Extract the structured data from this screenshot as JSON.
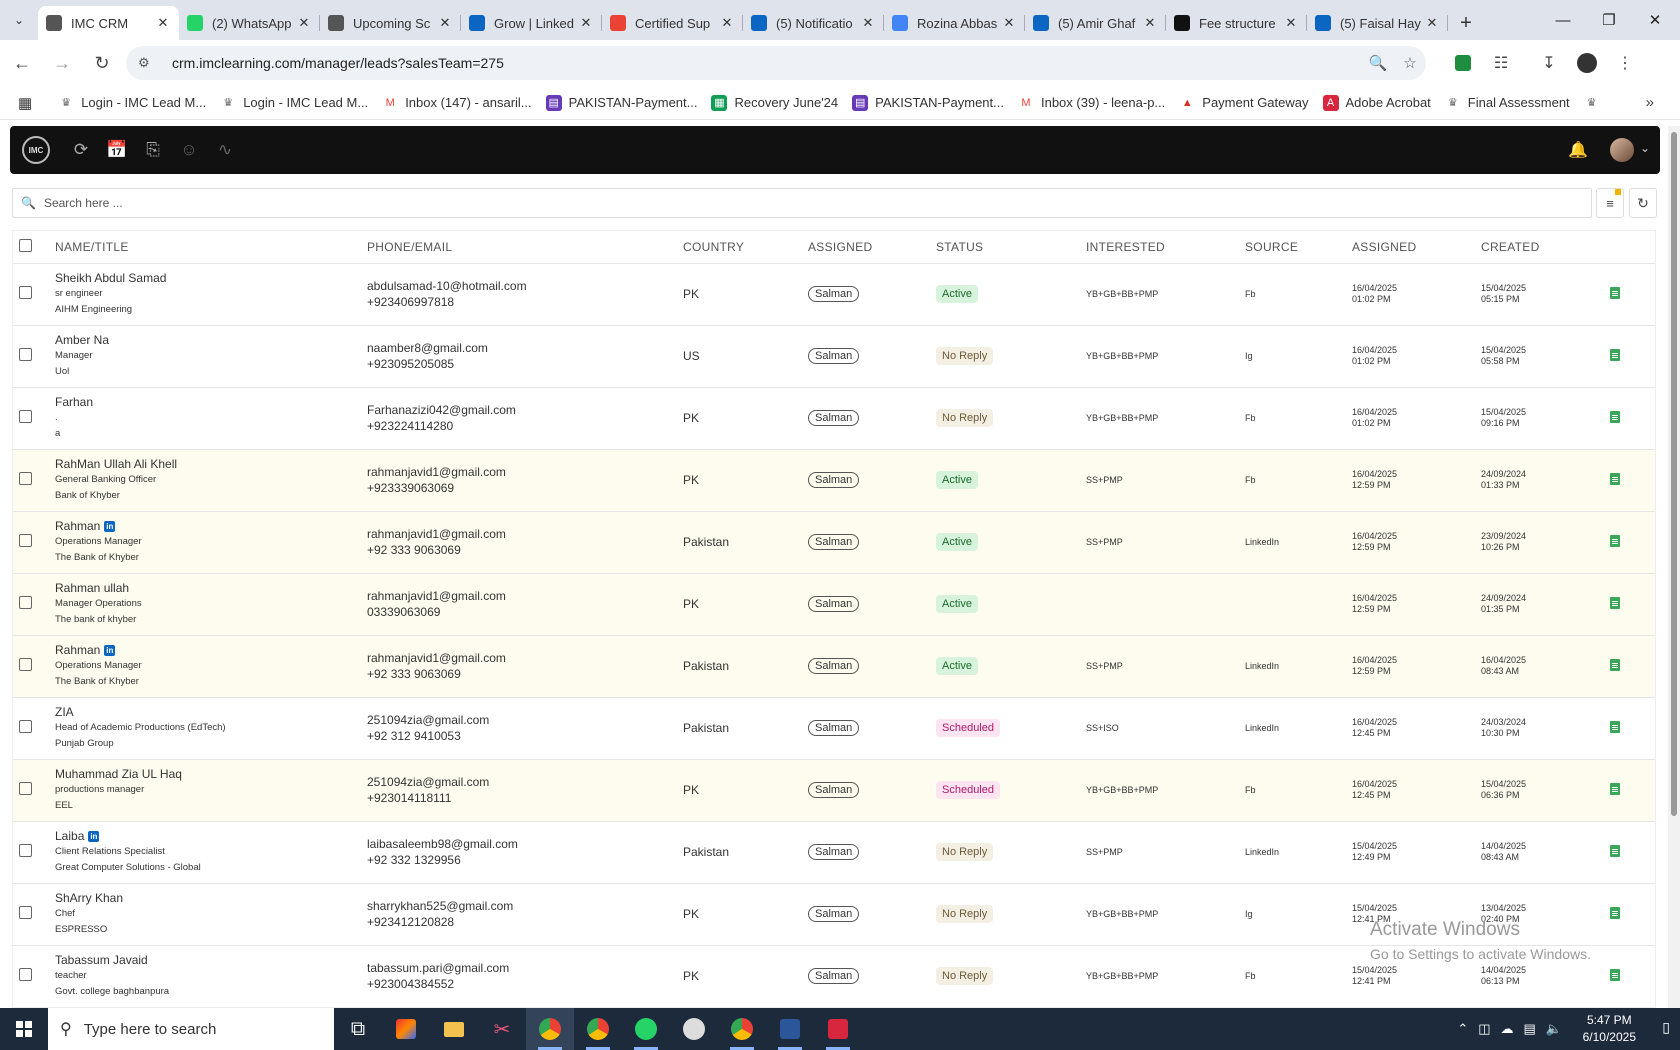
{
  "browser": {
    "tabs": [
      {
        "title": "IMC CRM",
        "active": true,
        "icon": "imc-icon",
        "color": "#555"
      },
      {
        "title": "(2) WhatsApp",
        "active": false,
        "icon": "whatsapp-icon",
        "color": "#25d366"
      },
      {
        "title": "Upcoming Sc",
        "active": false,
        "icon": "imc-icon",
        "color": "#555"
      },
      {
        "title": "Grow | Linked",
        "active": false,
        "icon": "linkedin-icon",
        "color": "#0a66c2"
      },
      {
        "title": "Certified Sup",
        "active": false,
        "icon": "gmail-icon",
        "color": "#ea4335"
      },
      {
        "title": "(5) Notificatio",
        "active": false,
        "icon": "linkedin-icon",
        "color": "#0a66c2"
      },
      {
        "title": "Rozina Abbas",
        "active": false,
        "icon": "google-icon",
        "color": "#4285f4"
      },
      {
        "title": "(5) Amir Ghaf",
        "active": false,
        "icon": "linkedin-icon",
        "color": "#0a66c2"
      },
      {
        "title": "Fee structure",
        "active": false,
        "icon": "openai-icon",
        "color": "#111"
      },
      {
        "title": "(5) Faisal Hay",
        "active": false,
        "icon": "linkedin-icon",
        "color": "#0a66c2"
      }
    ],
    "url": "crm.imclearning.com/manager/leads?salesTeam=275",
    "bookmarks": [
      {
        "label": "Login - IMC Lead M...",
        "icon": "imc-icon"
      },
      {
        "label": "Login - IMC Lead M...",
        "icon": "imc-icon"
      },
      {
        "label": "Inbox (147) - ansaril...",
        "icon": "gmail-icon"
      },
      {
        "label": "PAKISTAN-Payment...",
        "icon": "forms-icon"
      },
      {
        "label": "Recovery June'24",
        "icon": "sheets-icon"
      },
      {
        "label": "PAKISTAN-Payment...",
        "icon": "forms-icon"
      },
      {
        "label": "Inbox (39) - leena-p...",
        "icon": "gmail-icon"
      },
      {
        "label": "Payment Gateway",
        "icon": "arrow-icon"
      },
      {
        "label": "Adobe Acrobat",
        "icon": "acrobat-icon"
      },
      {
        "label": "Final Assessment",
        "icon": "imc-icon"
      }
    ]
  },
  "app": {
    "logo_text": "IMC",
    "search_placeholder": "Search here ..."
  },
  "table": {
    "headers": [
      "NAME/TITLE",
      "PHONE/EMAIL",
      "COUNTRY",
      "ASSIGNED",
      "STATUS",
      "INTERESTED",
      "SOURCE",
      "ASSIGNED",
      "CREATED"
    ],
    "rows": [
      {
        "name": "Sheikh Abdul Samad",
        "linkedin": false,
        "title": "sr engineer",
        "company": "AIHM Engineering",
        "email": "abdulsamad-10@hotmail.com",
        "phone": "+923406997818",
        "country": "PK",
        "assigned": "Salman",
        "status": "Active",
        "interested": "YB+GB+BB+PMP",
        "source": "Fb",
        "assigned_date": "16/04/2025",
        "assigned_time": "01:02 PM",
        "created_date": "15/04/2025",
        "created_time": "05:15 PM",
        "alt": false
      },
      {
        "name": "Amber Na",
        "linkedin": false,
        "title": "Manager",
        "company": "Uol",
        "email": "naamber8@gmail.com",
        "phone": "+923095205085",
        "country": "US",
        "assigned": "Salman",
        "status": "No Reply",
        "interested": "YB+GB+BB+PMP",
        "source": "Ig",
        "assigned_date": "16/04/2025",
        "assigned_time": "01:02 PM",
        "created_date": "15/04/2025",
        "created_time": "05:58 PM",
        "alt": false
      },
      {
        "name": "Farhan",
        "linkedin": false,
        "title": ".",
        "company": "a",
        "email": "Farhanazizi042@gmail.com",
        "phone": "+923224114280",
        "country": "PK",
        "assigned": "Salman",
        "status": "No Reply",
        "interested": "YB+GB+BB+PMP",
        "source": "Fb",
        "assigned_date": "16/04/2025",
        "assigned_time": "01:02 PM",
        "created_date": "15/04/2025",
        "created_time": "09:16 PM",
        "alt": false
      },
      {
        "name": "RahMan Ullah Ali Khell",
        "linkedin": false,
        "title": "General Banking Officer",
        "company": "Bank of Khyber",
        "email": "rahmanjavid1@gmail.com",
        "phone": "+923339063069",
        "country": "PK",
        "assigned": "Salman",
        "status": "Active",
        "interested": "SS+PMP",
        "source": "Fb",
        "assigned_date": "16/04/2025",
        "assigned_time": "12:59 PM",
        "created_date": "24/09/2024",
        "created_time": "01:33 PM",
        "alt": true
      },
      {
        "name": "Rahman",
        "linkedin": true,
        "title": "Operations Manager",
        "company": "The Bank of Khyber",
        "email": "rahmanjavid1@gmail.com",
        "phone": "+92 333 9063069",
        "country": "Pakistan",
        "assigned": "Salman",
        "status": "Active",
        "interested": "SS+PMP",
        "source": "LinkedIn",
        "assigned_date": "16/04/2025",
        "assigned_time": "12:59 PM",
        "created_date": "23/09/2024",
        "created_time": "10:26 PM",
        "alt": true
      },
      {
        "name": "Rahman ullah",
        "linkedin": false,
        "title": "Manager Operations",
        "company": "The bank of khyber",
        "email": "rahmanjavid1@gmail.com",
        "phone": "03339063069",
        "country": "PK",
        "assigned": "Salman",
        "status": "Active",
        "interested": "",
        "source": "",
        "assigned_date": "16/04/2025",
        "assigned_time": "12:59 PM",
        "created_date": "24/09/2024",
        "created_time": "01:35 PM",
        "alt": true
      },
      {
        "name": "Rahman",
        "linkedin": true,
        "title": "Operations Manager",
        "company": "The Bank of Khyber",
        "email": "rahmanjavid1@gmail.com",
        "phone": "+92 333 9063069",
        "country": "Pakistan",
        "assigned": "Salman",
        "status": "Active",
        "interested": "SS+PMP",
        "source": "LinkedIn",
        "assigned_date": "16/04/2025",
        "assigned_time": "12:59 PM",
        "created_date": "16/04/2025",
        "created_time": "08:43 AM",
        "alt": true
      },
      {
        "name": "ZIA",
        "linkedin": false,
        "title": "Head of Academic Productions (EdTech)",
        "company": "Punjab Group",
        "email": "251094zia@gmail.com",
        "phone": "+92 312 9410053",
        "country": "Pakistan",
        "assigned": "Salman",
        "status": "Scheduled",
        "interested": "SS+ISO",
        "source": "LinkedIn",
        "assigned_date": "16/04/2025",
        "assigned_time": "12:45 PM",
        "created_date": "24/03/2024",
        "created_time": "10:30 PM",
        "alt": false
      },
      {
        "name": "Muhammad Zia UL Haq",
        "linkedin": false,
        "title": "productions manager",
        "company": "EEL",
        "email": "251094zia@gmail.com",
        "phone": "+923014118111",
        "country": "PK",
        "assigned": "Salman",
        "status": "Scheduled",
        "interested": "YB+GB+BB+PMP",
        "source": "Fb",
        "assigned_date": "16/04/2025",
        "assigned_time": "12:45 PM",
        "created_date": "15/04/2025",
        "created_time": "06:36 PM",
        "alt": true
      },
      {
        "name": "Laiba",
        "linkedin": true,
        "title": "Client Relations Specialist",
        "company": "Great Computer Solutions - Global",
        "email": "laibasaleemb98@gmail.com",
        "phone": "+92 332 1329956",
        "country": "Pakistan",
        "assigned": "Salman",
        "status": "No Reply",
        "interested": "SS+PMP",
        "source": "LinkedIn",
        "assigned_date": "15/04/2025",
        "assigned_time": "12:49 PM",
        "created_date": "14/04/2025",
        "created_time": "08:43 AM",
        "alt": false
      },
      {
        "name": "ShArry Khan",
        "linkedin": false,
        "title": "Chef",
        "company": "ESPRESSO",
        "email": "sharrykhan525@gmail.com",
        "phone": "+923412120828",
        "country": "PK",
        "assigned": "Salman",
        "status": "No Reply",
        "interested": "YB+GB+BB+PMP",
        "source": "Ig",
        "assigned_date": "15/04/2025",
        "assigned_time": "12:41 PM",
        "created_date": "13/04/2025",
        "created_time": "02:40 PM",
        "alt": false
      },
      {
        "name": "Tabassum Javaid",
        "linkedin": false,
        "title": "teacher",
        "company": "Govt. college baghbanpura",
        "email": "tabassum.pari@gmail.com",
        "phone": "+923004384552",
        "country": "PK",
        "assigned": "Salman",
        "status": "No Reply",
        "interested": "YB+GB+BB+PMP",
        "source": "Fb",
        "assigned_date": "15/04/2025",
        "assigned_time": "12:41 PM",
        "created_date": "14/04/2025",
        "created_time": "06:13 PM",
        "alt": false
      }
    ]
  },
  "watermark": {
    "line1": "Activate Windows",
    "line2": "Go to Settings to activate Windows."
  },
  "taskbar": {
    "search_placeholder": "Type here to search",
    "time": "5:47 PM",
    "date": "6/10/2025"
  }
}
